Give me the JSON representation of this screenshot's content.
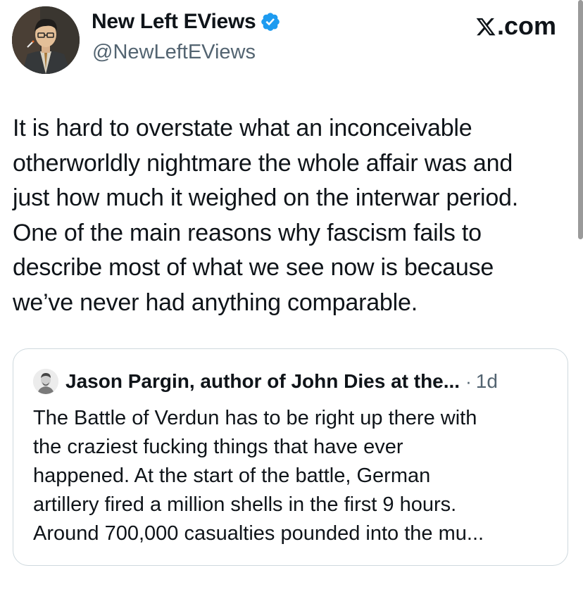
{
  "author": {
    "display_name": "New Left EViews",
    "handle": "@NewLeftEViews",
    "verified_icon": "verified-badge-icon",
    "verified_color": "#1d9bf0"
  },
  "brand": {
    "label": ".com",
    "icon": "x-logo-icon"
  },
  "tweet": {
    "lines": [
      "It is hard to overstate what an inconceivable",
      "otherworldly nightmare the whole affair was and",
      "just how much it weighed on the interwar period.",
      "One of the main reasons why fascism fails to",
      "describe most of what we see now is because",
      "we’ve never had anything comparable."
    ]
  },
  "quote": {
    "author_name": "Jason Pargin, author of John Dies at the...",
    "separator": "·",
    "time": "1d",
    "lines": [
      "The Battle of Verdun has to be right up there with",
      "the craziest fucking things that have ever",
      "happened. At the start of the battle, German",
      "artillery fired a million shells in the first 9 hours.",
      "Around 700,000 casualties pounded into the mu..."
    ]
  },
  "colors": {
    "text_primary": "#0f1419",
    "text_secondary": "#536471",
    "border": "#cfd9de"
  }
}
